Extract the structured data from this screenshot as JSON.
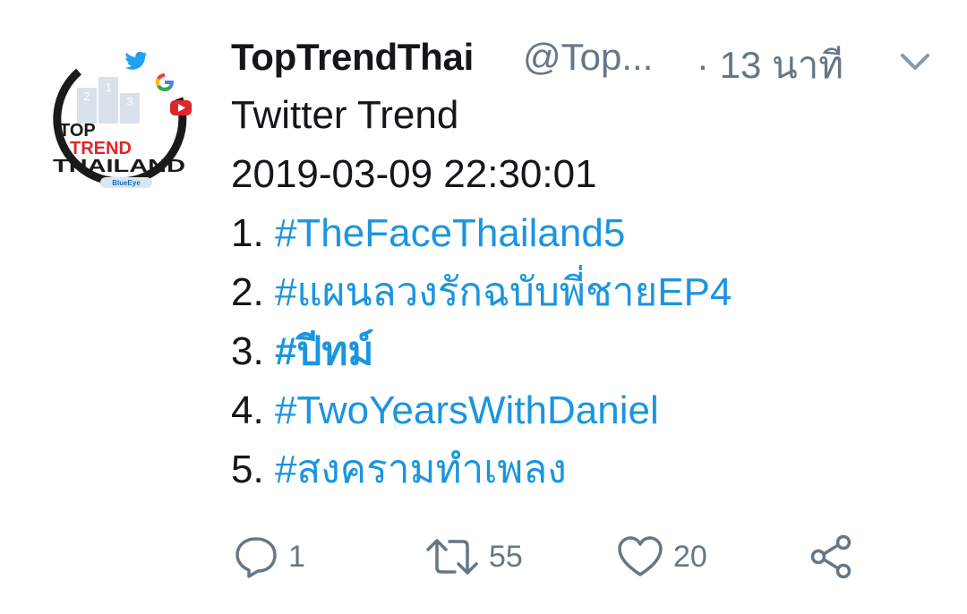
{
  "author": {
    "display_name": "TopTrendThai",
    "handle": "@Top...",
    "time": "· 13 นาที",
    "avatar": {
      "line1": "TOP",
      "line2": "TREND",
      "line3": "THAILAND",
      "podium": [
        "2",
        "1",
        "3"
      ],
      "badge": "BlueEye"
    }
  },
  "tweet": {
    "title": "Twitter Trend",
    "datetime": "2019-03-09 22:30:01",
    "trends": [
      {
        "num": "1.",
        "tag": "#TheFaceThailand5"
      },
      {
        "num": "2.",
        "tag": "#แผนลวงรักฉบับพี่ชายEP4"
      },
      {
        "num": "3.",
        "tag": "#ปีทม์"
      },
      {
        "num": "4.",
        "tag": "#TwoYearsWithDaniel"
      },
      {
        "num": "5.",
        "tag": "#สงครามทำเพลง"
      }
    ]
  },
  "actions": {
    "reply_count": "1",
    "retweet_count": "55",
    "like_count": "20"
  },
  "colors": {
    "link": "#1b95e0",
    "muted": "#657786",
    "text": "#14171a",
    "trend_red": "#e0262b"
  },
  "icons": {
    "reply": "reply-icon",
    "retweet": "retweet-icon",
    "like": "heart-icon",
    "share": "share-icon",
    "caret": "chevron-down-icon"
  }
}
